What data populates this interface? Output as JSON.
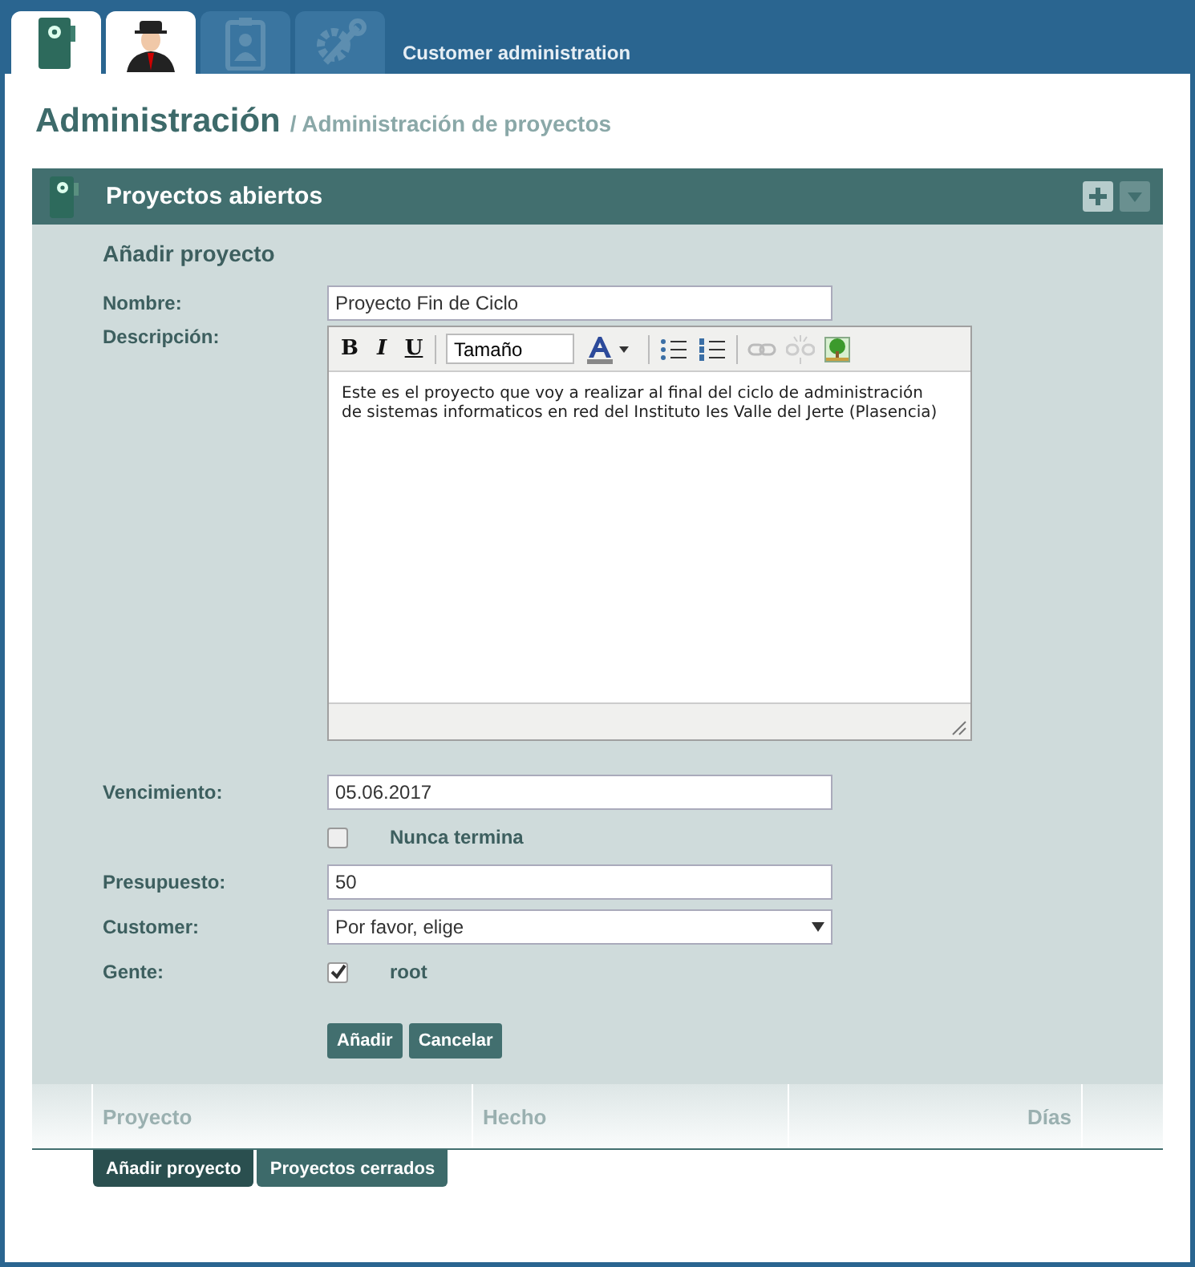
{
  "top_tabs": [
    {
      "kind": "folder",
      "selected": true
    },
    {
      "kind": "person",
      "selected": true
    },
    {
      "kind": "badge",
      "selected": false
    },
    {
      "kind": "tools",
      "selected": false
    }
  ],
  "top_link": "Customer administration",
  "heading": {
    "title": "Administración",
    "subtitle": "/ Administración de proyectos"
  },
  "panel": {
    "title": "Proyectos abiertos",
    "collapsed": false
  },
  "form": {
    "title": "Añadir proyecto",
    "name": {
      "label": "Nombre:",
      "value": "Proyecto Fin de Ciclo"
    },
    "description": {
      "label": "Descripción:",
      "toolbar": {
        "bold": "B",
        "italic": "I",
        "underline": "U",
        "size": "Tamaño"
      },
      "value": "Este es el proyecto que voy a realizar al final del ciclo de administración de sistemas informaticos en red del Instituto Ies Valle del Jerte (Plasencia)"
    },
    "due": {
      "label": "Vencimiento:",
      "value": "05.06.2017"
    },
    "never_ends": {
      "label": "Nunca termina",
      "checked": false
    },
    "budget": {
      "label": "Presupuesto:",
      "value": "50"
    },
    "customer": {
      "label": "Customer:",
      "value": "Por favor, elige"
    },
    "people": {
      "label": "Gente:",
      "items": [
        {
          "name": "root",
          "checked": true
        }
      ]
    },
    "buttons": [
      "Añadir",
      "Cancelar"
    ]
  },
  "table": {
    "columns": [
      "Proyecto",
      "Hecho",
      "Días"
    ]
  },
  "bottom_tabs": [
    {
      "label": "Añadir proyecto",
      "selected": true
    },
    {
      "label": "Proyectos cerrados",
      "selected": false
    }
  ]
}
